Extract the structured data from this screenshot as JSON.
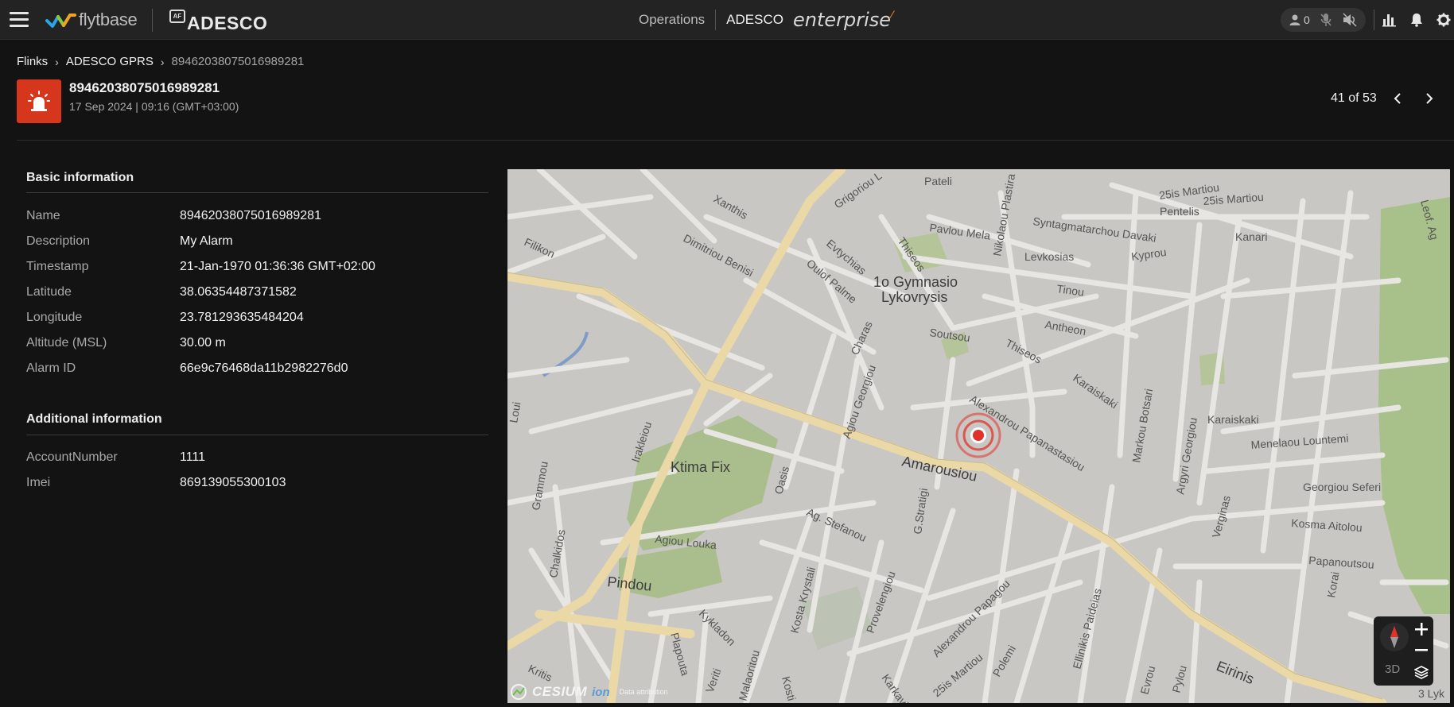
{
  "topbar": {
    "brand": "flytbase",
    "client_logo": "ADESCO",
    "client_mark": "AF",
    "nav_operations": "Operations",
    "nav_client": "ADESCO",
    "nav_enterprise": "enterprise",
    "pilot_count": "0"
  },
  "breadcrumb": {
    "items": [
      "Flinks",
      "ADESCO GPRS"
    ],
    "current": "89462038075016989281"
  },
  "header": {
    "title": "89462038075016989281",
    "subtitle": "17 Sep 2024 | 09:16 (GMT+03:00)",
    "pager": "41 of 53"
  },
  "basic_info": {
    "title": "Basic information",
    "rows": [
      {
        "label": "Name",
        "value": "89462038075016989281"
      },
      {
        "label": "Description",
        "value": "My Alarm"
      },
      {
        "label": "Timestamp",
        "value": "21-Jan-1970 01:36:36 GMT+02:00"
      },
      {
        "label": "Latitude",
        "value": "38.06354487371582"
      },
      {
        "label": "Longitude",
        "value": "23.781293635484204"
      },
      {
        "label": "Altitude (MSL)",
        "value": "30.00 m"
      },
      {
        "label": "Alarm ID",
        "value": "66e9c76468da11b2982276d0"
      }
    ]
  },
  "additional_info": {
    "title": "Additional information",
    "rows": [
      {
        "label": "AccountNumber",
        "value": "1111"
      },
      {
        "label": "Imei",
        "value": "869139055300103"
      }
    ]
  },
  "map": {
    "streets": {
      "grigoriou": "Grigoriou L",
      "xanthis": "Xanthis",
      "pateli": "Pateli",
      "martiou1": "25is Martiou",
      "martiou2": "25is Martiou",
      "pentelis": "Pentelis",
      "pavlou": "Pavlou Mela",
      "syntagmatarchou": "Syntagmatarchou Davaki",
      "kanari": "Kanari",
      "filikon": "Filikon",
      "dimitriou": "Dimitriou Benisi",
      "evtychias": "Evtychias",
      "oulof": "Oulof Palme",
      "thiseos1": "Thiseos",
      "nikolaou": "Nikolaou Plastira",
      "levkosias": "Levkosias",
      "kyprou": "Kyprou",
      "gymnasio1": "1o Gymnasio",
      "gymnasio2": "Lykovrysis",
      "tinou": "Tinou",
      "charas": "Charas",
      "soutsou": "Soutsou",
      "antheon": "Antheon",
      "thiseos2": "Thiseos",
      "karaiskaki1": "Karaiskaki",
      "karaiskaki2": "Karaiskaki",
      "markou": "Markou Botsari",
      "argyri": "Argyri Georgiou",
      "menelaou": "Menelaou Lountemi",
      "alexandrou": "Alexandrou Papanastasiou",
      "iraklelou": "Irakleiou",
      "agiou_georgiou": "Agiou Georgiou",
      "amarousiou": "Amarousiou",
      "ktima": "Ktima Fix",
      "oasis": "Oasis",
      "grammou": "Grammou",
      "stratigi": "G.Stratigi",
      "georgiou_seferi": "Georgiou Seferi",
      "verginas": "Verginas",
      "kosma": "Kosma Aitolou",
      "papanoutsou": "Papanoutsou",
      "agiou_louka": "Agiou Louka",
      "ag_stefanou": "Ag. Stefanou",
      "chalkidos": "Chalkidos",
      "pindou": "Pindou",
      "plapouta": "Plapouta",
      "kykladon": "Kykladon",
      "kosta": "Kosta Krystali",
      "provelengiou": "Provelengiou",
      "alexandrou_papagou": "Alexandrou Papagou",
      "ellinikis": "Ellinikis Paideias",
      "evrou": "Evrou",
      "pylou": "Pylou",
      "einnis": "Eirinis",
      "korai": "Korai",
      "kritis": "Kritis",
      "karkavitsa": "Karkavitsa",
      "martiou3": "25is Martiou",
      "polemi": "Polemi",
      "veriti": "Veriti",
      "malaoritou": "Malaoritou",
      "kosti": "Kosti Pala",
      "lykou": "3 Lyk",
      "loui": "Loui",
      "leof": "Leof. Ag"
    },
    "attribution_brand": "CESIUM",
    "attribution_ion": "ion",
    "attribution_link": "Data attribution",
    "btn_3d": "3D"
  },
  "colors": {
    "alarm_red": "#d5361c",
    "marker_red": "#e2302a",
    "accent_orange": "#e78a2b"
  },
  "icons": [
    "menu-icon",
    "flytbase-logo-icon",
    "user-icon",
    "mic-off-icon",
    "speaker-off-icon",
    "chart-icon",
    "bell-icon",
    "gear-icon",
    "siren-icon",
    "chevron-left-icon",
    "chevron-right-icon",
    "compass-icon",
    "plus-icon",
    "minus-icon",
    "layers-icon"
  ]
}
